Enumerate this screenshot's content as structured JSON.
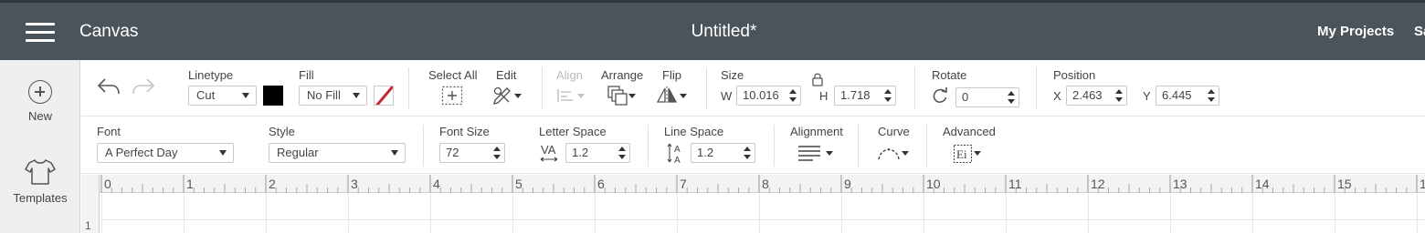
{
  "header": {
    "app_title": "Canvas",
    "document_title": "Untitled*",
    "my_projects": "My Projects",
    "save_truncated": "Save"
  },
  "sidebar": {
    "items": [
      {
        "label": "New",
        "icon": "plus-circle-icon"
      },
      {
        "label": "Templates",
        "icon": "shirt-icon"
      }
    ]
  },
  "toolbar_edit": {
    "linetype": {
      "label": "Linetype",
      "value": "Cut"
    },
    "fill": {
      "label": "Fill",
      "value": "No Fill"
    },
    "select_all": "Select All",
    "edit": "Edit",
    "align": "Align",
    "arrange": "Arrange",
    "flip": "Flip",
    "size": {
      "label": "Size",
      "w_label": "W",
      "w_value": "10.016",
      "h_label": "H",
      "h_value": "1.718"
    },
    "rotate": {
      "label": "Rotate",
      "value": "0"
    },
    "position": {
      "label": "Position",
      "x_label": "X",
      "x_value": "2.463",
      "y_label": "Y",
      "y_value": "6.445"
    },
    "colors": {
      "linetype_swatch": "#000000",
      "no_fill_slash": "#c0282e"
    }
  },
  "toolbar_text": {
    "font": {
      "label": "Font",
      "value": "A Perfect Day"
    },
    "style": {
      "label": "Style",
      "value": "Regular"
    },
    "font_size": {
      "label": "Font Size",
      "value": "72"
    },
    "letter_space": {
      "label": "Letter Space",
      "value": "1.2"
    },
    "line_space": {
      "label": "Line Space",
      "value": "1.2"
    },
    "alignment": "Alignment",
    "curve": "Curve",
    "advanced": "Advanced"
  },
  "ruler": {
    "marks": [
      "0",
      "1",
      "2",
      "3",
      "4",
      "5",
      "6",
      "7",
      "8",
      "9",
      "10",
      "11",
      "12",
      "13",
      "14",
      "15",
      "1"
    ],
    "vertical_marks": [
      "1"
    ]
  },
  "colors": {
    "header_bg": "#4b535b",
    "sidebar_bg": "#eeeff0"
  }
}
